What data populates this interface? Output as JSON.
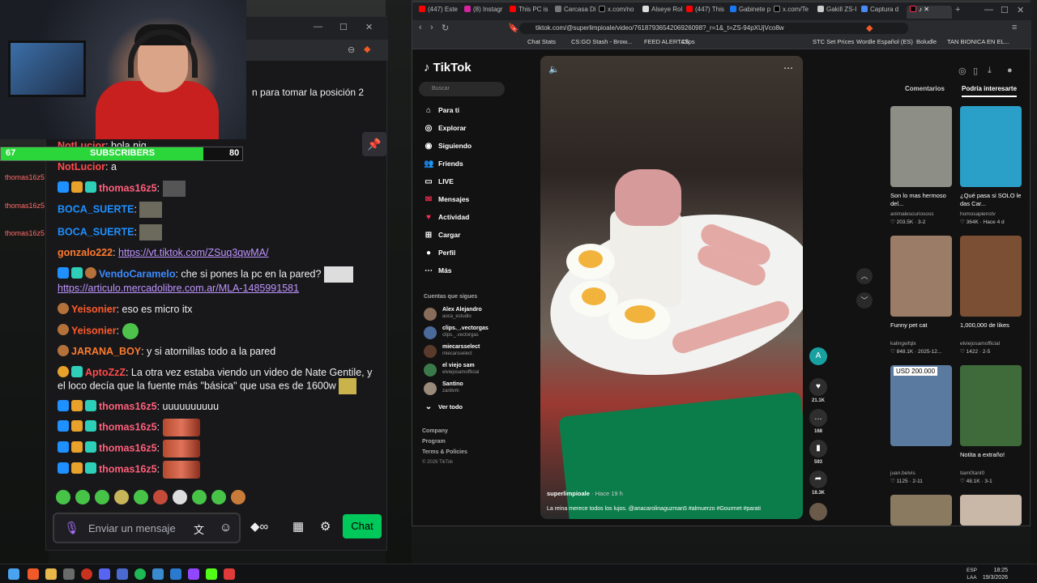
{
  "stream": {
    "subscribers": {
      "current": "67",
      "goal": "80",
      "label": "SUBSCRIBERS",
      "progress": 0.84
    },
    "side_badges": [
      "thomas16z5",
      "thomas16z5",
      "thomas16z5"
    ]
  },
  "chat": {
    "partial_system_text": "n para tomar la posición 2",
    "messages": [
      {
        "user": "NotLucior",
        "text": ": hola nig"
      },
      {
        "user": "NotLucior",
        "text": ": a"
      },
      {
        "user": "thomas16z5",
        "text": ":"
      },
      {
        "user": "BOCA_SUERTE",
        "text": ":"
      },
      {
        "user": "BOCA_SUERTE",
        "text": ":"
      },
      {
        "user": "gonzalo222",
        "text": ": ",
        "link": "https://vt.tiktok.com/ZSuq3qwMA/"
      },
      {
        "user": "VendoCaramelo",
        "text": ": che si pones la pc en la pared?",
        "link": "https://articulo.mercadolibre.com.ar/MLA-1485991581"
      },
      {
        "user": "Yeisonier",
        "text": ": eso es micro itx"
      },
      {
        "user": "Yeisonier",
        "text": ":"
      },
      {
        "user": "JARANA_BOY",
        "text": ": y si atornillas todo a la pared"
      },
      {
        "user": "AptoZzZ",
        "text": ": La otra vez estaba viendo un video de Nate Gentile, y",
        "text2": "el loco decía que la fuente más \"básica\" que usa es de 1600w"
      },
      {
        "user": "thomas16z5",
        "text": ": uuuuuuuuuu"
      },
      {
        "user": "thomas16z5",
        "text": ":"
      },
      {
        "user": "thomas16z5",
        "text": ":"
      },
      {
        "user": "thomas16z5",
        "text": ":"
      }
    ],
    "input_placeholder": "Enviar un mensaje",
    "send_label": "Chat",
    "colors": {
      "accent": "#00c85a",
      "link": "#bf94ff"
    }
  },
  "browser": {
    "tabs": [
      "(447) Este",
      "(8) Instagr",
      "This PC is",
      "Carcasa Di",
      "x.com/no",
      "Alseye Rol",
      "(447) This",
      "Gabinete p",
      "x.com/Te",
      "Gakill ZS-I",
      "Captura d"
    ],
    "url": "tiktok.com/@superlimpioale/video/7618793654206926098?_r=1&_t=ZS-94pXUjVco8w",
    "bookmarks": [
      "Chat Stats",
      "CS:GO Stash - Brow...",
      "FEED ALERTAS",
      "Clips",
      "STC Set Prices",
      "Wordle Español (ES)",
      "Boludle",
      "TAN BIONICA EN EL..."
    ]
  },
  "tiktok": {
    "logo": "TikTok",
    "search_placeholder": "Buscar",
    "nav": [
      {
        "label": "Para ti",
        "icon": "home-icon"
      },
      {
        "label": "Explorar",
        "icon": "compass-icon"
      },
      {
        "label": "Siguiendo",
        "icon": "following-icon"
      },
      {
        "label": "Friends",
        "icon": "friends-icon"
      },
      {
        "label": "LIVE",
        "icon": "live-icon"
      },
      {
        "label": "Mensajes",
        "icon": "message-icon"
      },
      {
        "label": "Actividad",
        "icon": "activity-icon"
      },
      {
        "label": "Cargar",
        "icon": "upload-icon"
      },
      {
        "label": "Perfil",
        "icon": "profile-icon"
      },
      {
        "label": "Más",
        "icon": "more-icon"
      }
    ],
    "following_title": "Cuentas que sigues",
    "following": [
      {
        "name": "Alex Alejandro",
        "handle": "aoca_estudio"
      },
      {
        "name": "clips._.vectorgas",
        "handle": "clips._.vectorgas"
      },
      {
        "name": "miecarsselect",
        "handle": "miecarsselect"
      },
      {
        "name": "el viejo sam",
        "handle": "elviejosamofficial"
      },
      {
        "name": "Santino",
        "handle": "zantivm"
      }
    ],
    "see_all": "Ver todo",
    "footer": [
      "Company",
      "Program",
      "Terms & Policies",
      "© 2026 TikTok"
    ],
    "video": {
      "author": "superlimpioale",
      "time": "· Hace 19 h",
      "caption": "La reina merece todos los lujos. @anacarolinaguzman5 #almuerzo #Gourmet #parati",
      "likes": "21.1K",
      "comments": "168",
      "saves": "593",
      "shares": "18.3K"
    },
    "right_tabs": [
      "Comentarios",
      "Podría interesarte"
    ],
    "cards": [
      {
        "title": "Son lo mas hermoso del...",
        "author": "animalescuriososs",
        "stats": "203.5K · 3-2",
        "color": "#8d8f86"
      },
      {
        "title": "¿Qué pasa si SOLO le das Car...",
        "author": "homosapienstv",
        "stats": "364K · Hace 4 d",
        "color": "#2aa0c8"
      },
      {
        "title": "Funny pet cat",
        "author": "kalingwfqlx",
        "stats": "848.1K · 2025-12...",
        "color": "#9b7c66"
      },
      {
        "title": "1,000,000 de likes",
        "author": "elviejosamofficial",
        "stats": "1422 · 2-5",
        "color": "#7a4f33"
      },
      {
        "title": "USD 200.000",
        "author": "juan.belvis",
        "stats": "1125 · 2-11",
        "color": "#5b7aa0"
      },
      {
        "title": "Notita a extraño!",
        "author": "tiam0tant0",
        "stats": "48.1K · 3-1",
        "color": "#3f6b3a"
      }
    ]
  },
  "taskbar": {
    "lang": [
      "ESP",
      "LAA"
    ],
    "time": "18:25",
    "date": "19/3/2026"
  }
}
